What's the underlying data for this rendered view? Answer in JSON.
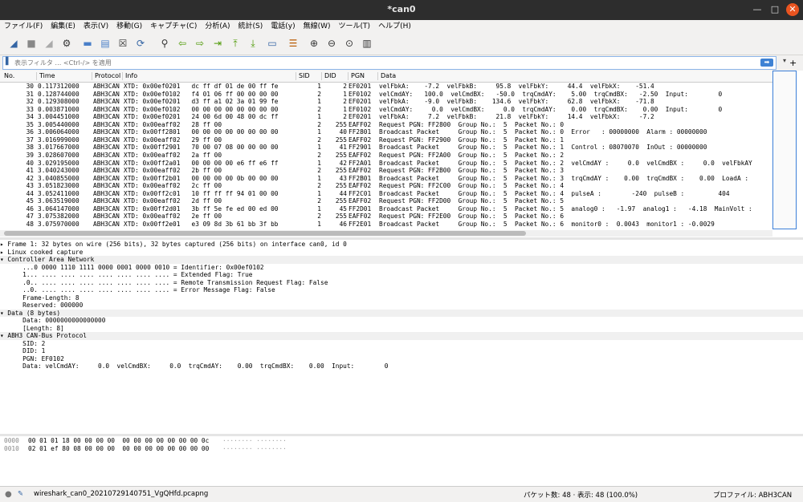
{
  "window": {
    "title": "*can0",
    "min_icon": "—",
    "max_icon": "□",
    "close_icon": "✕"
  },
  "menu": [
    "ファイル(F)",
    "編集(E)",
    "表示(V)",
    "移動(G)",
    "キャプチャ(C)",
    "分析(A)",
    "統計(S)",
    "電話(y)",
    "無線(W)",
    "ツール(T)",
    "ヘルプ(H)"
  ],
  "toolbar": {
    "icons": [
      {
        "name": "shark-fin-start-icon",
        "glyph": "◢",
        "color": "#3465a4"
      },
      {
        "name": "stop-icon",
        "glyph": "■",
        "color": "#888888"
      },
      {
        "name": "restart-icon",
        "glyph": "◢",
        "color": "#aaaaaa"
      },
      {
        "name": "options-gear-icon",
        "glyph": "⚙",
        "color": "#333333"
      },
      {
        "name": "open-folder-icon",
        "glyph": "▬",
        "color": "#4a7fc8"
      },
      {
        "name": "save-file-icon",
        "glyph": "▤",
        "color": "#4a7fc8"
      },
      {
        "name": "close-file-icon",
        "glyph": "☒",
        "color": "#333333"
      },
      {
        "name": "reload-icon",
        "glyph": "⟳",
        "color": "#3465a4"
      },
      {
        "name": "find-icon",
        "glyph": "⚲",
        "color": "#333333"
      },
      {
        "name": "back-arrow-icon",
        "glyph": "⇦",
        "color": "#4e9a06"
      },
      {
        "name": "forward-arrow-icon",
        "glyph": "⇨",
        "color": "#4e9a06"
      },
      {
        "name": "goto-packet-icon",
        "glyph": "⇥",
        "color": "#4e9a06"
      },
      {
        "name": "first-packet-icon",
        "glyph": "⤒",
        "color": "#4e9a06"
      },
      {
        "name": "last-packet-icon",
        "glyph": "⤓",
        "color": "#4e9a06"
      },
      {
        "name": "autoscroll-icon",
        "glyph": "▭",
        "color": "#3465a4"
      },
      {
        "name": "colorize-icon",
        "glyph": "☰",
        "color": "#b85a00"
      },
      {
        "name": "zoom-in-icon",
        "glyph": "⊕",
        "color": "#333333"
      },
      {
        "name": "zoom-out-icon",
        "glyph": "⊖",
        "color": "#333333"
      },
      {
        "name": "zoom-normal-icon",
        "glyph": "⊙",
        "color": "#333333"
      },
      {
        "name": "resize-columns-icon",
        "glyph": "▥",
        "color": "#333333"
      }
    ]
  },
  "filter": {
    "placeholder": "表示フィルタ … <Ctrl-/> を適用",
    "bookmark_icon": "▌",
    "apply_icon": "➡",
    "dropdown_icon": "▾",
    "add_icon": "+"
  },
  "columns": [
    "No.",
    "Time",
    "Protocol",
    "Info",
    "SID",
    "DID",
    "PGN",
    "Data"
  ],
  "packets": [
    {
      "no": "30",
      "time": "0.117312000",
      "protocol": "ABH3CAN",
      "info": "XTD: 0x00ef0201   dc ff df 01 de 00 ff fe",
      "sid": "1",
      "did": "2",
      "pgn": "EF0201",
      "data": "velFbkA:    -7.2  velFbkB:     95.8  velFbkY:     44.4  velFbkX:    -51.4"
    },
    {
      "no": "31",
      "time": "0.128744000",
      "protocol": "ABH3CAN",
      "info": "XTD: 0x00ef0102   f4 01 06 ff 00 00 00 00",
      "sid": "2",
      "did": "1",
      "pgn": "EF0102",
      "data": "velCmdAY:   100.0  velCmdBX:   -50.0  trqCmdAY:    5.00  trqCmdBX:   -2.50  Input:        0"
    },
    {
      "no": "32",
      "time": "0.129308000",
      "protocol": "ABH3CAN",
      "info": "XTD: 0x00ef0201   d3 ff a1 02 3a 01 99 fe",
      "sid": "1",
      "did": "2",
      "pgn": "EF0201",
      "data": "velFbkA:    -9.0  velFbkB:    134.6  velFbkY:     62.8  velFbkX:    -71.8"
    },
    {
      "no": "33",
      "time": "0.003871000",
      "protocol": "ABH3CAN",
      "info": "XTD: 0x00ef0102   00 00 00 00 00 00 00 00",
      "sid": "2",
      "did": "1",
      "pgn": "EF0102",
      "data": "velCmdAY:     0.0  velCmdBX:     0.0  trqCmdAY:    0.00  trqCmdBX:    0.00  Input:        0"
    },
    {
      "no": "34",
      "time": "3.004451000",
      "protocol": "ABH3CAN",
      "info": "XTD: 0x00ef0201   24 00 6d 00 48 00 dc ff",
      "sid": "1",
      "did": "2",
      "pgn": "EF0201",
      "data": "velFbkA:     7.2  velFbkB:     21.8  velFbkY:     14.4  velFbkX:     -7.2"
    },
    {
      "no": "35",
      "time": "3.005440000",
      "protocol": "ABH3CAN",
      "info": "XTD: 0x00eaff02   28 ff 00",
      "sid": "2",
      "did": "255",
      "pgn": "EAFF02",
      "data": "Request PGN: FF2800  Group No.:  5  Packet No.: 0"
    },
    {
      "no": "36",
      "time": "3.006064000",
      "protocol": "ABH3CAN",
      "info": "XTD: 0x00ff2801   00 00 00 00 00 00 00 00",
      "sid": "1",
      "did": "40",
      "pgn": "FF2801",
      "data": "Broadcast Packet     Group No.:  5  Packet No.: 0  Error   : 00000000  Alarm : 00000000"
    },
    {
      "no": "37",
      "time": "3.016999000",
      "protocol": "ABH3CAN",
      "info": "XTD: 0x00eaff02   29 ff 00",
      "sid": "2",
      "did": "255",
      "pgn": "EAFF02",
      "data": "Request PGN: FF2900  Group No.:  5  Packet No.: 1"
    },
    {
      "no": "38",
      "time": "3.017667000",
      "protocol": "ABH3CAN",
      "info": "XTD: 0x00ff2901   70 00 07 08 00 00 00 00",
      "sid": "1",
      "did": "41",
      "pgn": "FF2901",
      "data": "Broadcast Packet     Group No.:  5  Packet No.: 1  Control : 08070070  InOut : 00000000"
    },
    {
      "no": "39",
      "time": "3.028607000",
      "protocol": "ABH3CAN",
      "info": "XTD: 0x00eaff02   2a ff 00",
      "sid": "2",
      "did": "255",
      "pgn": "EAFF02",
      "data": "Request PGN: FF2A00  Group No.:  5  Packet No.: 2"
    },
    {
      "no": "40",
      "time": "3.029195000",
      "protocol": "ABH3CAN",
      "info": "XTD: 0x00ff2a01   00 00 00 00 e6 ff e6 ff",
      "sid": "1",
      "did": "42",
      "pgn": "FF2A01",
      "data": "Broadcast Packet     Group No.:  5  Packet No.: 2  velCmdAY :     0.0  velCmdBX :     0.0  velFbkAY"
    },
    {
      "no": "41",
      "time": "3.040243000",
      "protocol": "ABH3CAN",
      "info": "XTD: 0x00eaff02   2b ff 00",
      "sid": "2",
      "did": "255",
      "pgn": "EAFF02",
      "data": "Request PGN: FF2B00  Group No.:  5  Packet No.: 3"
    },
    {
      "no": "42",
      "time": "3.040855000",
      "protocol": "ABH3CAN",
      "info": "XTD: 0x00ff2b01   00 00 00 00 0b 00 00 00",
      "sid": "1",
      "did": "43",
      "pgn": "FF2B01",
      "data": "Broadcast Packet     Group No.:  5  Packet No.: 3  trqCmdAY :    0.00  trqCmdBX :    0.00  LoadA :"
    },
    {
      "no": "43",
      "time": "3.051823000",
      "protocol": "ABH3CAN",
      "info": "XTD: 0x00eaff02   2c ff 00",
      "sid": "2",
      "did": "255",
      "pgn": "EAFF02",
      "data": "Request PGN: FF2C00  Group No.:  5  Packet No.: 4"
    },
    {
      "no": "44",
      "time": "3.052411000",
      "protocol": "ABH3CAN",
      "info": "XTD: 0x00ff2c01   10 ff ff ff 94 01 00 00",
      "sid": "1",
      "did": "44",
      "pgn": "FF2C01",
      "data": "Broadcast Packet     Group No.:  5  Packet No.: 4  pulseA :        -240  pulseB :         404"
    },
    {
      "no": "45",
      "time": "3.063519000",
      "protocol": "ABH3CAN",
      "info": "XTD: 0x00eaff02   2d ff 00",
      "sid": "2",
      "did": "255",
      "pgn": "EAFF02",
      "data": "Request PGN: FF2D00  Group No.:  5  Packet No.: 5"
    },
    {
      "no": "46",
      "time": "3.064147000",
      "protocol": "ABH3CAN",
      "info": "XTD: 0x00ff2d01   3b ff 5e fe ed 00 ed 00",
      "sid": "1",
      "did": "45",
      "pgn": "FF2D01",
      "data": "Broadcast Packet     Group No.:  5  Packet No.: 5  analog0 :   -1.97  analog1 :   -4.18  MainVolt :"
    },
    {
      "no": "47",
      "time": "3.075382000",
      "protocol": "ABH3CAN",
      "info": "XTD: 0x00eaff02   2e ff 00",
      "sid": "2",
      "did": "255",
      "pgn": "EAFF02",
      "data": "Request PGN: FF2E00  Group No.:  5  Packet No.: 6"
    },
    {
      "no": "48",
      "time": "3.075970000",
      "protocol": "ABH3CAN",
      "info": "XTD: 0x00ff2e01   e3 09 8d 3b 61 bb 3f bb",
      "sid": "1",
      "did": "46",
      "pgn": "FF2E01",
      "data": "Broadcast Packet     Group No.:  5  Packet No.: 6  monitor0 :  0.0043  monitor1 : -0.0029"
    }
  ],
  "details": [
    {
      "text": "▸ Frame 1: 32 bytes on wire (256 bits), 32 bytes captured (256 bits) on interface can0, id 0",
      "hl": false
    },
    {
      "text": "▸ Linux cooked capture",
      "hl": false
    },
    {
      "text": "▾ Controller Area Network",
      "hl": true
    },
    {
      "text": "      ...0 0000 1110 1111 0000 0001 0000 0010 = Identifier: 0x00ef0102",
      "hl": false
    },
    {
      "text": "      1... .... .... .... .... .... .... .... = Extended Flag: True",
      "hl": false
    },
    {
      "text": "      .0.. .... .... .... .... .... .... .... = Remote Transmission Request Flag: False",
      "hl": false
    },
    {
      "text": "      ..0. .... .... .... .... .... .... .... = Error Message Flag: False",
      "hl": false
    },
    {
      "text": "      Frame-Length: 8",
      "hl": false
    },
    {
      "text": "      Reserved: 000000",
      "hl": false
    },
    {
      "text": "▾ Data (8 bytes)",
      "hl": true
    },
    {
      "text": "      Data: 0000000000000000",
      "hl": false
    },
    {
      "text": "      [Length: 8]",
      "hl": false
    },
    {
      "text": "▾ ABH3 CAN-Bus Protocol",
      "hl": true
    },
    {
      "text": "      SID: 2",
      "hl": false
    },
    {
      "text": "      DID: 1",
      "hl": false
    },
    {
      "text": "      PGN: EF0102",
      "hl": false
    },
    {
      "text": "      Data: velCmdAY:     0.0  velCmdBX:     0.0  trqCmdAY:    0.00  trqCmdBX:    0.00  Input:        0",
      "hl": false
    }
  ],
  "hex": [
    {
      "offset": "0000",
      "bytes": "00 01 01 18 00 00 00 00  00 00 00 00 00 00 00 0c",
      "ascii": "········ ········"
    },
    {
      "offset": "0010",
      "bytes": "02 01 ef 80 08 00 00 00  00 00 00 00 00 00 00 00",
      "ascii": "········ ········"
    }
  ],
  "status": {
    "file": "wireshark_can0_20210729140751_VgQHfd.pcapng",
    "packets": "パケット数: 48 · 表示: 48 (100.0%)",
    "profile": "プロファイル: ABH3CAN"
  }
}
